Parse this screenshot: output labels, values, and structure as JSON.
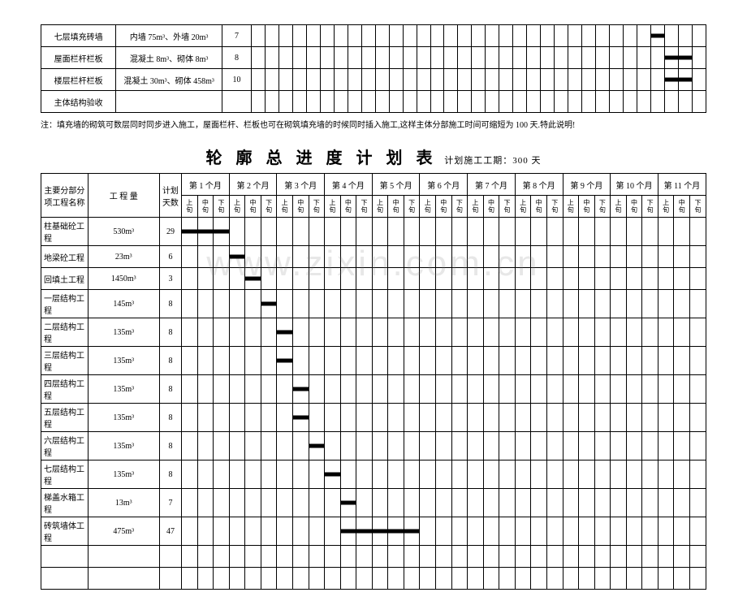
{
  "top_rows": [
    {
      "name": "七层填充砖墙",
      "qty": "内墙 75m³、外墙 20m³",
      "days": "7",
      "bar_start": 29,
      "bar_end": 30
    },
    {
      "name": "屋面栏杆栏板",
      "qty": "混凝土 8m³、砌体 8m³",
      "days": "8",
      "bar_start": 30,
      "bar_end": 32
    },
    {
      "name": "楼层栏杆栏板",
      "qty": "混凝土 30m³、砌体 458m³",
      "days": "10",
      "bar_start": 30,
      "bar_end": 32
    },
    {
      "name": "主体结构验收",
      "qty": "",
      "days": "",
      "bar_start": 0,
      "bar_end": 0
    }
  ],
  "top_slots": 33,
  "note": "注：填充墙的砌筑可数层同时同步进入施工，屋面栏杆、栏板也可在砌筑填充墙的时候同时插入施工,这样主体分部施工时间可缩短为 100 天.特此说明!",
  "title_main": "轮 廓 总 进 度 计 划 表",
  "title_sub": "计划施工工期：300 天",
  "header": {
    "col1": "主要分部分\n项工程名称",
    "col2": "工 程 量",
    "col3": "计划\n天数",
    "months": [
      "第 1 个月",
      "第 2 个月",
      "第 3 个月",
      "第 4 个月",
      "第 5 个月",
      "第 6 个月",
      "第 7 个月",
      "第 8 个月",
      "第 9 个月",
      "第 10 个月",
      "第 11 个月"
    ],
    "sub": [
      "上旬",
      "中旬",
      "下旬"
    ]
  },
  "rows": [
    {
      "name": "柱基础砼工程",
      "qty": "530m³",
      "days": "29",
      "bar_start": 0,
      "bar_end": 3
    },
    {
      "name": "地梁砼工程",
      "qty": "23m³",
      "days": "6",
      "bar_start": 3,
      "bar_end": 4
    },
    {
      "name": "回填土工程",
      "qty": "1450m³",
      "days": "3",
      "bar_start": 4,
      "bar_end": 5
    },
    {
      "name": "一层结构工程",
      "qty": "145m³",
      "days": "8",
      "bar_start": 5,
      "bar_end": 6
    },
    {
      "name": "二层结构工程",
      "qty": "135m³",
      "days": "8",
      "bar_start": 6,
      "bar_end": 7
    },
    {
      "name": "三层结构工程",
      "qty": "135m³",
      "days": "8",
      "bar_start": 6,
      "bar_end": 7
    },
    {
      "name": "四层结构工程",
      "qty": "135m³",
      "days": "8",
      "bar_start": 7,
      "bar_end": 8
    },
    {
      "name": "五层结构工程",
      "qty": "135m³",
      "days": "8",
      "bar_start": 7,
      "bar_end": 8
    },
    {
      "name": "六层结构工程",
      "qty": "135m³",
      "days": "8",
      "bar_start": 8,
      "bar_end": 9
    },
    {
      "name": "七层结构工程",
      "qty": "135m³",
      "days": "8",
      "bar_start": 9,
      "bar_end": 10
    },
    {
      "name": "梯盖水箱工程",
      "qty": "13m³",
      "days": "7",
      "bar_start": 10,
      "bar_end": 11
    },
    {
      "name": "砖筑墙体工程",
      "qty": "475m³",
      "days": "47",
      "bar_start": 10,
      "bar_end": 15
    }
  ],
  "bottom_slots": 33,
  "watermark": "www.zixin.com.cn"
}
